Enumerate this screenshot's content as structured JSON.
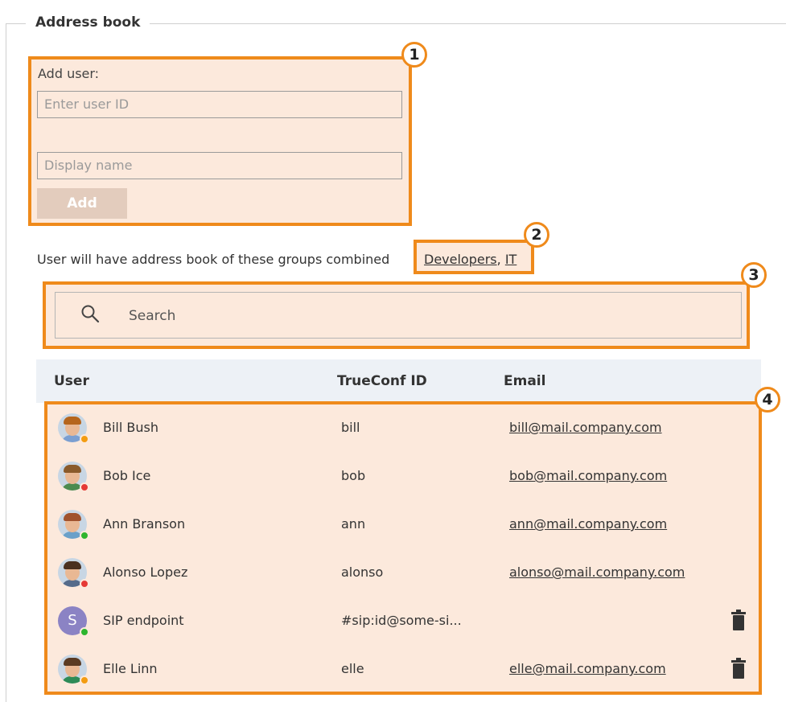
{
  "section": {
    "legend": "Address book"
  },
  "add_user": {
    "label": "Add user:",
    "user_id_placeholder": "Enter user ID",
    "display_name_placeholder": "Display name",
    "add_button": "Add"
  },
  "groups": {
    "text": "User will have address book of these groups combined",
    "links": [
      "Developers",
      "IT"
    ],
    "separator": ","
  },
  "search": {
    "placeholder": "Search",
    "icon": "search-icon"
  },
  "table": {
    "columns": [
      "User",
      "TrueConf ID",
      "Email"
    ],
    "rows": [
      {
        "name": "Bill Bush",
        "id": "bill",
        "email": "bill@mail.company.com",
        "status": "orange",
        "avatar": "photo",
        "hair": "#b5651d",
        "shirt": "#7b9fd1",
        "deletable": false
      },
      {
        "name": "Bob Ice",
        "id": "bob",
        "email": "bob@mail.company.com",
        "status": "red",
        "avatar": "photo",
        "hair": "#8a5a2b",
        "shirt": "#4c8a4f",
        "deletable": false
      },
      {
        "name": "Ann Branson",
        "id": "ann",
        "email": "ann@mail.company.com",
        "status": "green",
        "avatar": "photo",
        "hair": "#a0522d",
        "shirt": "#6aa0c9",
        "deletable": false
      },
      {
        "name": "Alonso Lopez",
        "id": "alonso",
        "email": "alonso@mail.company.com",
        "status": "red",
        "avatar": "photo",
        "hair": "#4a3020",
        "shirt": "#556b8a",
        "deletable": false
      },
      {
        "name": "SIP endpoint",
        "id": "#sip:id@some-si...",
        "email": "",
        "status": "green",
        "avatar": "letter",
        "letter": "S",
        "deletable": true
      },
      {
        "name": "Elle Linn",
        "id": "elle",
        "email": "elle@mail.company.com",
        "status": "orange",
        "avatar": "photo",
        "hair": "#5a3a22",
        "shirt": "#2e8b57",
        "deletable": true
      }
    ]
  },
  "callouts": [
    "1",
    "2",
    "3",
    "4"
  ],
  "colors": {
    "highlight_border": "#ef8a1b",
    "highlight_fill": "#fce9dc",
    "status_green": "#2db52d",
    "status_red": "#e53935",
    "status_orange": "#f39c12",
    "header_bg": "#edf1f6"
  }
}
